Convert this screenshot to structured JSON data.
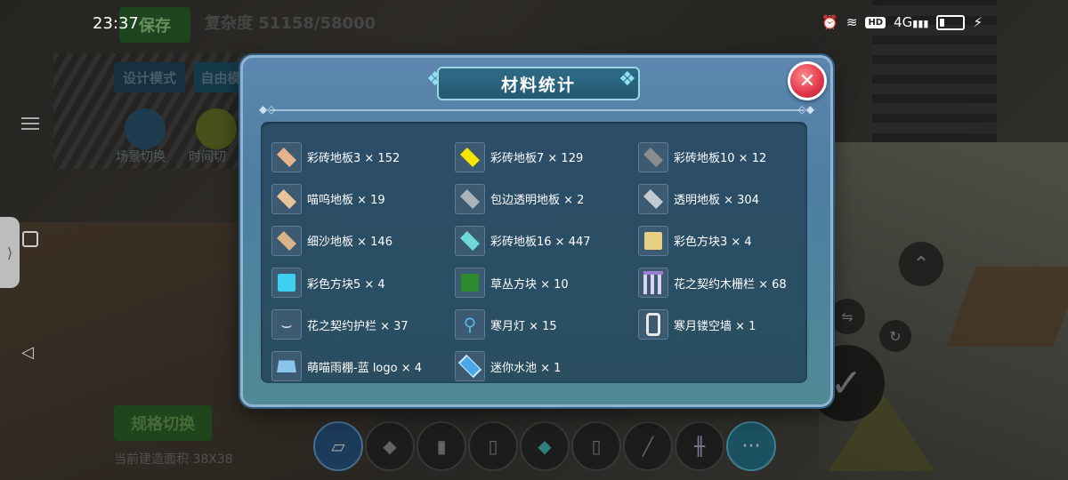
{
  "status_bar": {
    "time": "23:37",
    "icons": [
      "alarm-icon",
      "wifi-icon",
      "hd-icon",
      "signal-icon",
      "battery-icon",
      "charging-icon"
    ],
    "hd_label": "HD",
    "net_label": "4G"
  },
  "hud": {
    "save_label": "保存",
    "complexity_text": "复杂度 51158/58000",
    "design_mode_label": "设计模式",
    "free_mode_label": "自由模",
    "scene_switch_label": "场景切换",
    "time_switch_label": "时间切",
    "spec_switch_label": "规格切换",
    "area_label": "当前建造面积 38X38"
  },
  "modal": {
    "title": "材料统计",
    "close_icon": "close-icon",
    "items": [
      {
        "label": "彩砖地板3 × 152",
        "icon": "tile-icon",
        "color": "#e6b48a"
      },
      {
        "label": "彩砖地板7 × 129",
        "icon": "tile-icon",
        "color": "#f4e600"
      },
      {
        "label": "彩砖地板10 × 12",
        "icon": "tile-icon",
        "color": "#8c8c8c"
      },
      {
        "label": "喵呜地板 × 19",
        "icon": "tile-icon",
        "color": "#e8c49a"
      },
      {
        "label": "包边透明地板 × 2",
        "icon": "tile-icon",
        "color": "#a9b3bb"
      },
      {
        "label": "透明地板 × 304",
        "icon": "tile-icon",
        "color": "#c3ccd3"
      },
      {
        "label": "细沙地板 × 146",
        "icon": "tile-icon",
        "color": "#d8b48a"
      },
      {
        "label": "彩砖地板16 × 447",
        "icon": "tile-icon",
        "color": "#6fd8d8"
      },
      {
        "label": "彩色方块3 × 4",
        "icon": "cube-icon",
        "color": "#e8d084"
      },
      {
        "label": "彩色方块5 × 4",
        "icon": "cube-icon",
        "color": "#3ed0f0"
      },
      {
        "label": "草丛方块 × 10",
        "icon": "grass-cube-icon",
        "color": "#2e8a2e"
      },
      {
        "label": "花之契约木栅栏 × 68",
        "icon": "fence-icon",
        "color": "#c8b8e8"
      },
      {
        "label": "花之契约护栏 × 37",
        "icon": "railing-icon",
        "color": "#e8e0f4"
      },
      {
        "label": "寒月灯 × 15",
        "icon": "lamp-icon",
        "color": "#5ab0e0"
      },
      {
        "label": "寒月镂空墙 × 1",
        "icon": "hollow-wall-icon",
        "color": "#e8e8e8"
      },
      {
        "label": "萌喵雨棚-蓝 logo × 4",
        "icon": "awning-icon",
        "color": "#8ac4ea"
      },
      {
        "label": "迷你水池 × 1",
        "icon": "pool-icon",
        "color": "#4aa8e8"
      }
    ]
  },
  "toolbar": {
    "tools": [
      "eraser-icon",
      "floor-tile-icon",
      "door-frame-icon",
      "panel-icon",
      "teal-tile-icon",
      "cabinet-icon",
      "ladder-icon",
      "fence-icon",
      "more-icon"
    ],
    "more_label": "···"
  },
  "colors": {
    "modal_top": "#5d87b0",
    "modal_bottom": "#4f8a95",
    "panel": "#2b4d68",
    "close_button": "#e0354a",
    "title_banner": "#2f6b86"
  }
}
